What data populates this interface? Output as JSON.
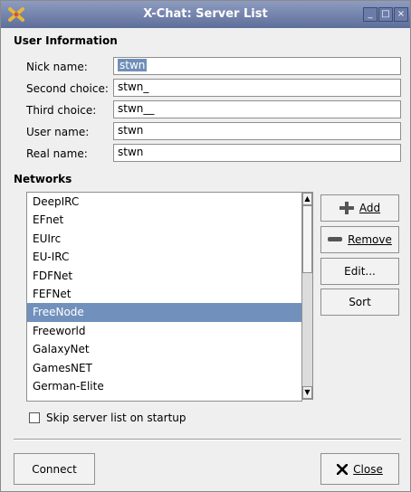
{
  "window": {
    "title": "X-Chat: Server List"
  },
  "user_info": {
    "heading": "User Information",
    "fields": [
      {
        "label": "Nick name:",
        "value": "stwn"
      },
      {
        "label": "Second choice:",
        "value": "stwn_"
      },
      {
        "label": "Third choice:",
        "value": "stwn__"
      },
      {
        "label": "User name:",
        "value": "stwn"
      },
      {
        "label": "Real name:",
        "value": "stwn"
      }
    ]
  },
  "networks": {
    "heading": "Networks",
    "items": [
      "DeepIRC",
      "EFnet",
      "EUIrc",
      "EU-IRC",
      "FDFNet",
      "FEFNet",
      "FreeNode",
      "Freeworld",
      "GalaxyNet",
      "GamesNET",
      "German-Elite"
    ],
    "selected": "FreeNode"
  },
  "buttons": {
    "add": "Add",
    "remove": "Remove",
    "edit": "Edit...",
    "sort": "Sort",
    "connect": "Connect",
    "close": "Close"
  },
  "options": {
    "skip_label": "Skip server list on startup",
    "skip_checked": false
  },
  "icons": {
    "app": "xchat-app-icon",
    "add": "plus-icon",
    "remove": "minus-icon",
    "close": "x-icon"
  },
  "colors": {
    "titlebar": "#6f80ab",
    "selection": "#7191bc"
  }
}
